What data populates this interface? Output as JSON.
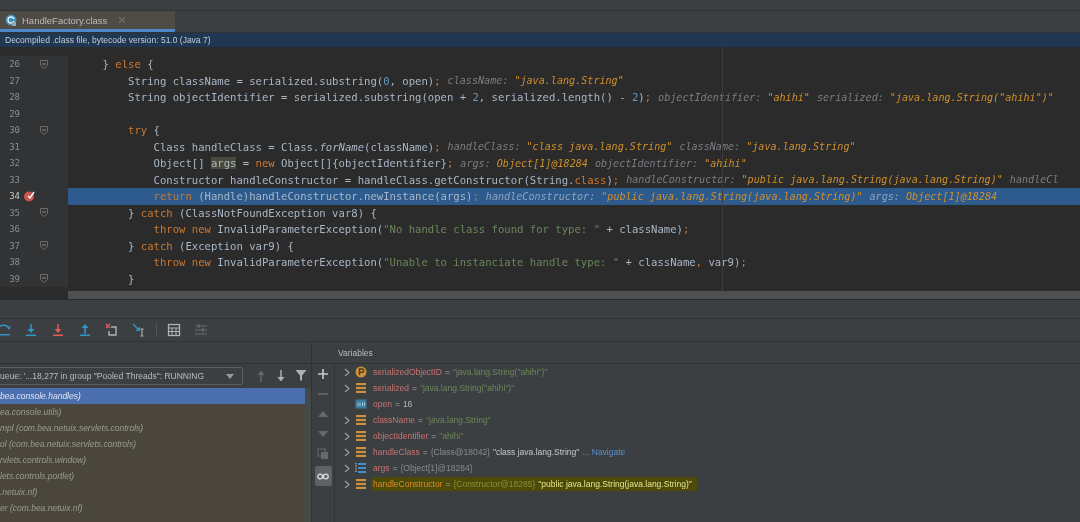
{
  "tabs": [
    {
      "label": "HandleFactory.class",
      "selected": true
    }
  ],
  "info_bar": {
    "text": "Decompiled .class file, bytecode version: 51.0 (Java 7)"
  },
  "editor": {
    "lines": [
      {
        "number": "26",
        "fold": true,
        "breakpoint": false,
        "current": false,
        "segments": [
          {
            "kind": "plain",
            "text": "    } "
          },
          {
            "kind": "kw",
            "text": "else"
          },
          {
            "kind": "plain",
            "text": " {"
          }
        ]
      },
      {
        "number": "27",
        "fold": false,
        "breakpoint": false,
        "current": false,
        "segments": [
          {
            "kind": "plain",
            "text": "        String className = serialized.substring("
          },
          {
            "kind": "num",
            "text": "0"
          },
          {
            "kind": "plain",
            "text": ", open)"
          },
          {
            "kind": "kw",
            "text": ";"
          },
          {
            "kind": "hint",
            "name": "className:",
            "value": "\"java.lang.String\""
          }
        ]
      },
      {
        "number": "28",
        "fold": false,
        "breakpoint": false,
        "current": false,
        "segments": [
          {
            "kind": "plain",
            "text": "        String objectIdentifier = serialized.substring(open + "
          },
          {
            "kind": "num",
            "text": "2"
          },
          {
            "kind": "plain",
            "text": ", serialized.length() - "
          },
          {
            "kind": "num",
            "text": "2"
          },
          {
            "kind": "plain",
            "text": ")"
          },
          {
            "kind": "kw",
            "text": ";"
          },
          {
            "kind": "hint",
            "name": "objectIdentifier:",
            "value": "\"ahihi\""
          },
          {
            "kind": "hint",
            "name": "serialized:",
            "value": "\"java.lang.String(\"ahihi\")\""
          }
        ]
      },
      {
        "number": "29",
        "fold": false,
        "breakpoint": false,
        "current": false
      },
      {
        "number": "30",
        "fold": true,
        "breakpoint": false,
        "current": false,
        "segments": [
          {
            "kind": "kw",
            "text": "        try"
          },
          {
            "kind": "plain",
            "text": " {"
          }
        ]
      },
      {
        "number": "31",
        "fold": false,
        "breakpoint": false,
        "current": false,
        "segments": [
          {
            "kind": "plain",
            "text": "            Class handleClass = Class."
          },
          {
            "kind": "italic",
            "text": "forName"
          },
          {
            "kind": "plain",
            "text": "(className)"
          },
          {
            "kind": "kw",
            "text": ";"
          },
          {
            "kind": "hint",
            "name": "handleClass:",
            "value": "\"class java.lang.String\""
          },
          {
            "kind": "hint",
            "name": "className:",
            "value": "\"java.lang.String\""
          }
        ]
      },
      {
        "number": "32",
        "fold": false,
        "breakpoint": false,
        "current": false,
        "segments": [
          {
            "kind": "plain",
            "text": "            Object[] "
          },
          {
            "kind": "usage",
            "text": "args"
          },
          {
            "kind": "plain",
            "text": " = "
          },
          {
            "kind": "kw",
            "text": "new"
          },
          {
            "kind": "plain",
            "text": " Object[]{objectIdentifier}"
          },
          {
            "kind": "kw",
            "text": ";"
          },
          {
            "kind": "hint",
            "name": "args:",
            "value": "Object[1]@18284"
          },
          {
            "kind": "hint",
            "name": "objectIdentifier:",
            "value": "\"ahihi\""
          }
        ]
      },
      {
        "number": "33",
        "fold": false,
        "breakpoint": false,
        "current": false,
        "segments": [
          {
            "kind": "plain",
            "text": "            Constructor handleConstructor = handleClass.getConstructor(String."
          },
          {
            "kind": "kw",
            "text": "class"
          },
          {
            "kind": "plain",
            "text": ")"
          },
          {
            "kind": "kw",
            "text": ";"
          },
          {
            "kind": "hint",
            "name": "handleConstructor:",
            "value": "\"public java.lang.String(java.lang.String)\""
          },
          {
            "kind": "hint",
            "name": "handleCl"
          }
        ]
      },
      {
        "number": "34",
        "fold": false,
        "breakpoint": true,
        "current": true,
        "segments": [
          {
            "kind": "kw",
            "text": "            return"
          },
          {
            "kind": "plain",
            "text": " (Handle)handleConstructor.newInstance(args)"
          },
          {
            "kind": "kw",
            "text": ";"
          },
          {
            "kind": "hint",
            "name": "handleConstructor:",
            "value": "\"public java.lang.String(java.lang.String)\""
          },
          {
            "kind": "hint",
            "name": "args:",
            "value": "Object[1]@18284"
          }
        ]
      },
      {
        "number": "35",
        "fold": true,
        "breakpoint": false,
        "current": false,
        "segments": [
          {
            "kind": "plain",
            "text": "        } "
          },
          {
            "kind": "kw",
            "text": "catch"
          },
          {
            "kind": "plain",
            "text": " (ClassNotFoundException var8) {"
          }
        ]
      },
      {
        "number": "36",
        "fold": false,
        "breakpoint": false,
        "current": false,
        "segments": [
          {
            "kind": "kw",
            "text": "            throw new"
          },
          {
            "kind": "plain",
            "text": " InvalidParameterException("
          },
          {
            "kind": "str",
            "text": "\"No handle class found for type: \""
          },
          {
            "kind": "plain",
            "text": " + className)"
          },
          {
            "kind": "kw",
            "text": ";"
          }
        ]
      },
      {
        "number": "37",
        "fold": true,
        "breakpoint": false,
        "current": false,
        "segments": [
          {
            "kind": "plain",
            "text": "        } "
          },
          {
            "kind": "kw",
            "text": "catch"
          },
          {
            "kind": "plain",
            "text": " (Exception var9) {"
          }
        ]
      },
      {
        "number": "38",
        "fold": false,
        "breakpoint": false,
        "current": false,
        "segments": [
          {
            "kind": "kw",
            "text": "            throw new"
          },
          {
            "kind": "plain",
            "text": " InvalidParameterException("
          },
          {
            "kind": "str",
            "text": "\"Unable to instanciate handle type: \""
          },
          {
            "kind": "plain",
            "text": " + className"
          },
          {
            "kind": "kw",
            "text": ","
          },
          {
            "kind": "plain",
            "text": " var9)"
          },
          {
            "kind": "kw",
            "text": ";"
          }
        ]
      },
      {
        "number": "39",
        "fold": true,
        "breakpoint": false,
        "current": false,
        "segments": [
          {
            "kind": "plain",
            "text": "        }"
          }
        ]
      }
    ]
  },
  "debug_toolbar": [
    {
      "kind": "over",
      "disabled": false
    },
    {
      "kind": "into",
      "disabled": false
    },
    {
      "kind": "force",
      "disabled": false
    },
    {
      "kind": "out",
      "disabled": false
    },
    {
      "kind": "drop",
      "disabled": false
    },
    {
      "kind": "cursor",
      "disabled": false
    },
    {
      "kind": "evaluate",
      "disabled": false
    },
    {
      "kind": "trace",
      "disabled": true
    }
  ],
  "frames": {
    "thread": "ueue: '...18,277 in group \"Pooled Threads\": RUNNING",
    "buttons": [
      {
        "kind": "up",
        "disabled": true
      },
      {
        "kind": "down",
        "disabled": false
      },
      {
        "kind": "filter",
        "disabled": false
      }
    ],
    "items": [
      {
        "text": "bea.console.handles)",
        "selected": true
      },
      {
        "text": "ea.console.utils)",
        "selected": false
      },
      {
        "text": "mpl (com.bea.netuix.servlets.controls)",
        "selected": false
      },
      {
        "text": "ol (com.bea.netuix.servlets.controls)",
        "selected": false
      },
      {
        "text": "rvlets.controls.window)",
        "selected": false
      },
      {
        "text": "lets.controls.portlet)",
        "selected": false
      },
      {
        "text": ".netuix.nf)",
        "selected": false
      },
      {
        "text": "er (com.bea.netuix.nf)",
        "selected": false
      }
    ]
  },
  "variables": {
    "title": "Variables",
    "toolbar": [
      {
        "kind": "add",
        "disabled": false,
        "selected": false
      },
      {
        "kind": "remove",
        "disabled": true,
        "selected": false
      },
      {
        "kind": "up",
        "disabled": true,
        "selected": false
      },
      {
        "kind": "down",
        "disabled": true,
        "selected": false
      },
      {
        "kind": "copy",
        "disabled": true,
        "selected": false
      },
      {
        "kind": "glasses",
        "disabled": false,
        "selected": true
      }
    ],
    "items": [
      {
        "name": "serializedObjectID",
        "kind": "parameter",
        "expandable": true,
        "marked": false,
        "operator": "=",
        "value": [
          {
            "kind": "string",
            "text": "\"java.lang.String(\"ahihi\")\""
          }
        ]
      },
      {
        "name": "serialized",
        "kind": "field",
        "expandable": true,
        "marked": false,
        "operator": "=",
        "value": [
          {
            "kind": "string",
            "text": "\"java.lang.String(\"ahihi\")\""
          }
        ]
      },
      {
        "name": "open",
        "kind": "primitive",
        "expandable": false,
        "marked": false,
        "operator": "=",
        "value": [
          {
            "kind": "number",
            "text": "16"
          }
        ]
      },
      {
        "name": "className",
        "kind": "field",
        "expandable": true,
        "marked": false,
        "operator": "=",
        "value": [
          {
            "kind": "string",
            "text": "\"java.lang.String\""
          }
        ]
      },
      {
        "name": "objectIdentifier",
        "kind": "field",
        "expandable": true,
        "marked": false,
        "operator": "=",
        "value": [
          {
            "kind": "string",
            "text": "\"ahihi\""
          }
        ]
      },
      {
        "name": "handleClass",
        "kind": "field",
        "expandable": true,
        "marked": false,
        "operator": "=",
        "value": [
          {
            "kind": "ref",
            "text": "{Class@18042}"
          },
          {
            "kind": "plain",
            "text": "\"class java.lang.String\""
          },
          {
            "kind": "link",
            "text": "... Navigate"
          }
        ]
      },
      {
        "name": "args",
        "kind": "array",
        "expandable": true,
        "marked": false,
        "operator": "=",
        "value": [
          {
            "kind": "ref",
            "text": "{Object[1]@18284}"
          }
        ]
      },
      {
        "name": "handleConstructor",
        "kind": "field",
        "expandable": true,
        "marked": true,
        "operator": "=",
        "value": [
          {
            "kind": "ref",
            "text": "{Constructor@18285}"
          },
          {
            "kind": "plain",
            "text": "\"public java.lang.String(java.lang.String)\""
          }
        ]
      }
    ]
  }
}
